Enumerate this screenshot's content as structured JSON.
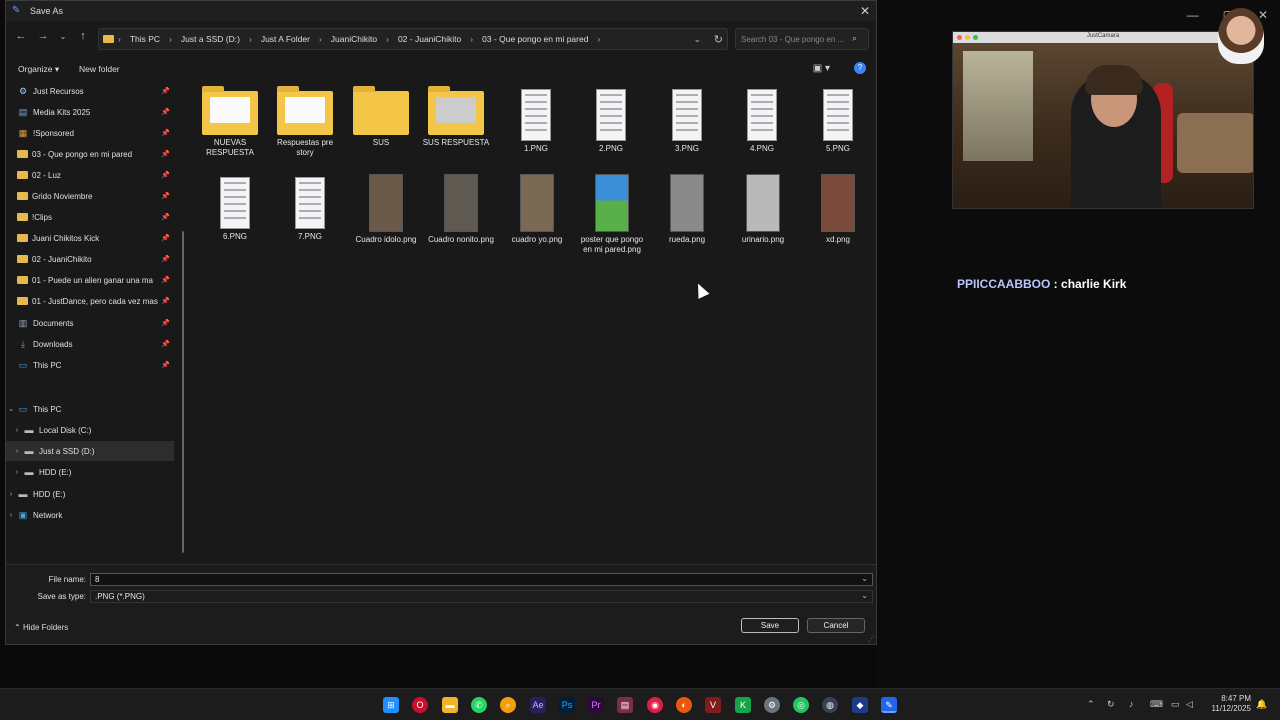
{
  "dialog": {
    "title": "Save As",
    "breadcrumb": [
      "This PC",
      "Just a SSD (D:)",
      "Just A Folder",
      "JuaniChikito",
      "02 - JuaniChikito",
      "03 - Que pongo en mi pared"
    ],
    "search_placeholder": "Search 03 - Que pongo en ...",
    "organize_label": "Organize",
    "new_folder_label": "New folder",
    "sidebar": {
      "quick": [
        {
          "label": "Just Recursos",
          "icon": "gear-icon"
        },
        {
          "label": "Media Kits 2025",
          "icon": "media-icon"
        },
        {
          "label": "!Sponsored",
          "icon": "sponsored-icon"
        },
        {
          "label": "03 - Que pongo en mi pared",
          "icon": "folder-icon"
        },
        {
          "label": "02 - Luz",
          "icon": "folder-icon"
        },
        {
          "label": "Grido Noviembre",
          "icon": "folder-icon"
        },
        {
          "label": "!Clips",
          "icon": "folder-icon"
        },
        {
          "label": "Juani Chikitos Kick",
          "icon": "folder-icon"
        },
        {
          "label": "02 - JuaniChikito",
          "icon": "folder-icon"
        },
        {
          "label": "01 - Puede un alien ganar una ma",
          "icon": "folder-icon"
        },
        {
          "label": "01 - JustDance, pero cada vez mas",
          "icon": "folder-icon"
        },
        {
          "label": "Documents",
          "icon": "documents-icon"
        },
        {
          "label": "Downloads",
          "icon": "downloads-icon"
        },
        {
          "label": "This PC",
          "icon": "pc-icon"
        }
      ],
      "tree": [
        {
          "label": "This PC",
          "icon": "pc-icon"
        },
        {
          "label": "Local Disk (C:)",
          "icon": "drive-icon"
        },
        {
          "label": "Just a SSD (D:)",
          "icon": "drive-icon"
        },
        {
          "label": "HDD (E:)",
          "icon": "drive-icon"
        },
        {
          "label": "HDD (E:)",
          "icon": "drive-icon"
        },
        {
          "label": "Network",
          "icon": "network-icon"
        }
      ]
    },
    "files": [
      {
        "name": "NUEVAS RESPUESTA",
        "kind": "folder-doc"
      },
      {
        "name": "Respuestas pre story",
        "kind": "folder-doc"
      },
      {
        "name": "SUS",
        "kind": "folder"
      },
      {
        "name": "SUS RESPUESTA",
        "kind": "folder-doc"
      },
      {
        "name": "1.PNG",
        "kind": "doc"
      },
      {
        "name": "2.PNG",
        "kind": "doc"
      },
      {
        "name": "3.PNG",
        "kind": "doc"
      },
      {
        "name": "4.PNG",
        "kind": "doc"
      },
      {
        "name": "5.PNG",
        "kind": "doc"
      },
      {
        "name": "6.PNG",
        "kind": "doc"
      },
      {
        "name": "7.PNG",
        "kind": "doc"
      },
      {
        "name": "Cuadro idolo.png",
        "kind": "photo",
        "color": "#6b5a4a"
      },
      {
        "name": "Cuadro nonito.png",
        "kind": "photo",
        "color": "#5e5a52"
      },
      {
        "name": "cuadro yo.png",
        "kind": "photo",
        "color": "#7a6a55"
      },
      {
        "name": "poster que pongo en mi pared.png",
        "kind": "photo",
        "color": "#3a8fd6"
      },
      {
        "name": "rueda.png",
        "kind": "photo",
        "color": "#8a8a8a"
      },
      {
        "name": "urinario.png",
        "kind": "photo",
        "color": "#b9b9b9"
      },
      {
        "name": "xd.png",
        "kind": "photo",
        "color": "#7a4a3a"
      }
    ],
    "file_name_label": "File name:",
    "file_name_value": "8",
    "save_type_label": "Save as type:",
    "save_type_value": ".PNG (*.PNG)",
    "hide_folders_label": "Hide Folders",
    "save_label": "Save",
    "cancel_label": "Cancel"
  },
  "camera": {
    "title": "JustCamara"
  },
  "chat": {
    "user": "PPIICCAABBOO",
    "separator": " : ",
    "message": "charlie Kirk"
  },
  "taskbar": {
    "time": "8:47 PM",
    "date": "11/12/2025"
  }
}
